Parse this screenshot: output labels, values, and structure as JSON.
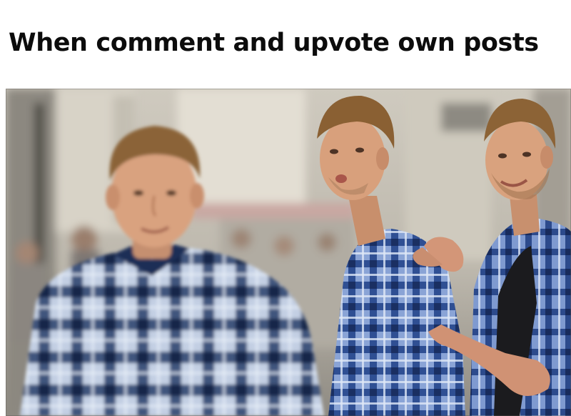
{
  "caption": {
    "text": "When comment and upvote own posts"
  },
  "photo": {
    "subject": "distracted-boyfriend-meme",
    "palette": {
      "background_light": "#d9d4c9",
      "background_mid": "#a9a49a",
      "building_shadow": "#6f6b63",
      "skin": "#d9a07e",
      "skin_shadow": "#b7795a",
      "hair": "#8a6236",
      "shirt_blue_dark": "#1f3a6e",
      "shirt_blue_mid": "#4b6fb0",
      "shirt_light": "#b9c8e2",
      "undershirt": "#1c1c1e"
    }
  }
}
